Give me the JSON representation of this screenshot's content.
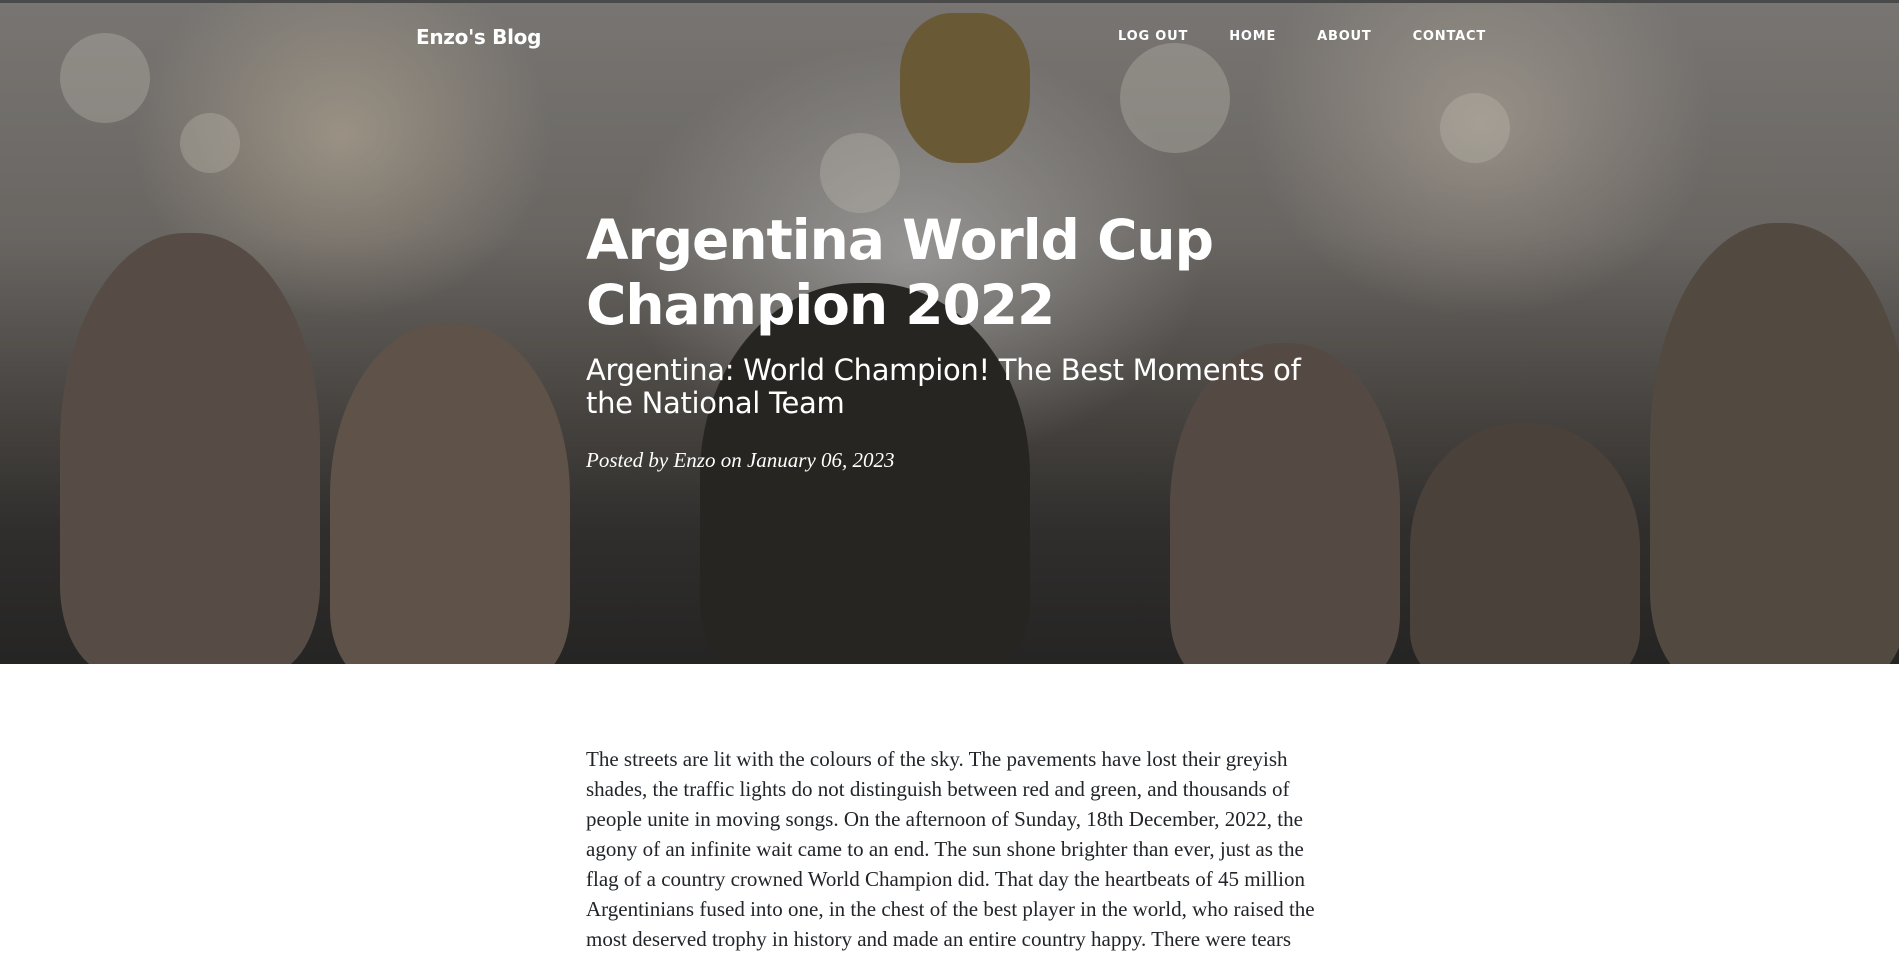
{
  "nav": {
    "brand": "Enzo's Blog",
    "links": [
      "LOG OUT",
      "HOME",
      "ABOUT",
      "CONTACT"
    ]
  },
  "post": {
    "title": "Argentina World Cup Champion 2022",
    "subtitle": "Argentina: World Champion! The Best Moments of the National Team",
    "meta": "Posted by Enzo on January 06, 2023",
    "body": "The streets are lit with the colours of the sky. The pavements have lost their greyish shades, the traffic lights do not distinguish between red and green, and thousands of people unite in moving songs. On the afternoon of Sunday, 18th December, 2022, the agony of an infinite wait came to an end. The sun shone brighter than ever, just as the flag of a country crowned World Champion did. That day the heartbeats of 45 million Argentinians fused into one, in the chest of the best player in the world, who raised the most deserved trophy in history and made an entire country happy. There were tears"
  }
}
